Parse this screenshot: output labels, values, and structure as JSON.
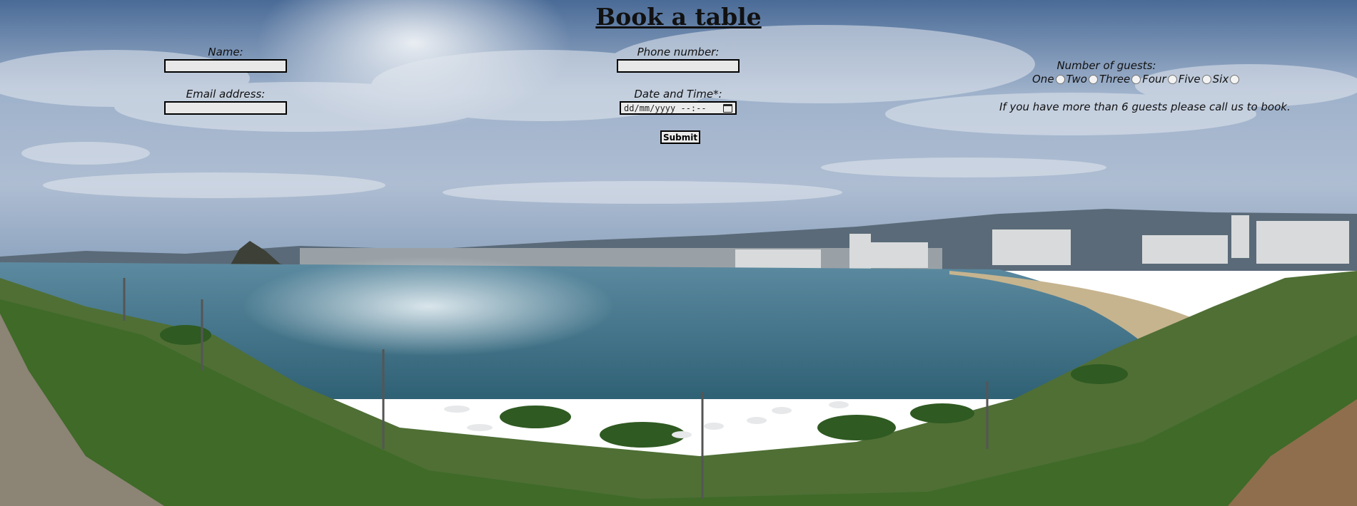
{
  "title": "Book a table",
  "form": {
    "name_label": "Name:",
    "name_value": "",
    "email_label": "Email address:",
    "email_value": "",
    "phone_label": "Phone number:",
    "phone_value": "",
    "datetime_label": "Date and Time*:",
    "datetime_placeholder": "dd/mm/yyyy --:--",
    "submit_label": "Submit",
    "guests_label": "Number of guests:",
    "guest_options": [
      "One",
      "Two",
      "Three",
      "Four",
      "Five",
      "Six"
    ],
    "large_party_note": "If you have more than 6 guests please call us to book."
  },
  "icons": {
    "datetime_picker": "calendar-icon"
  },
  "colors": {
    "sky_top": "#3f5f8e",
    "sky_mid": "#8fa6c4",
    "sea": "#3f6f86",
    "vegetation": "#3f6e2a"
  }
}
